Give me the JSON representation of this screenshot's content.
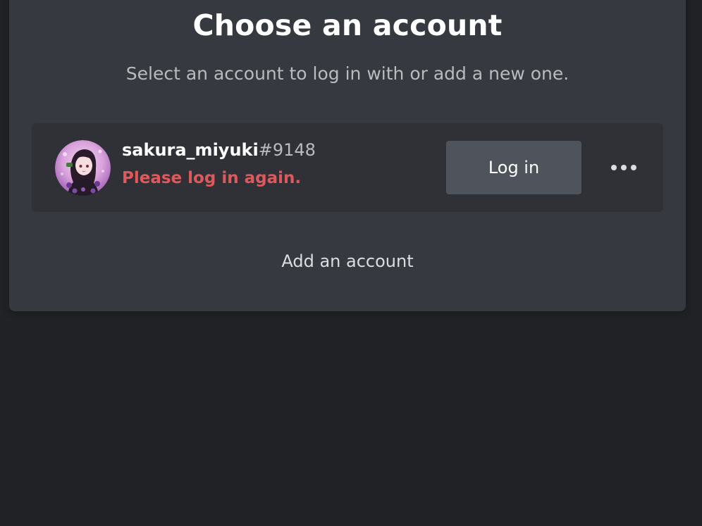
{
  "header": {
    "title": "Choose an account",
    "subtitle": "Select an account to log in with or add a new one."
  },
  "account": {
    "username": "sakura_miyuki",
    "discriminator": "#9148",
    "status_message": "Please log in again.",
    "login_label": "Log in",
    "more_icon": "more-horizontal-icon"
  },
  "footer": {
    "add_account_label": "Add an account"
  },
  "colors": {
    "background": "#202225",
    "panel": "#36393f",
    "card": "#2f3136",
    "button": "#4f545c",
    "error": "#e0585b"
  }
}
